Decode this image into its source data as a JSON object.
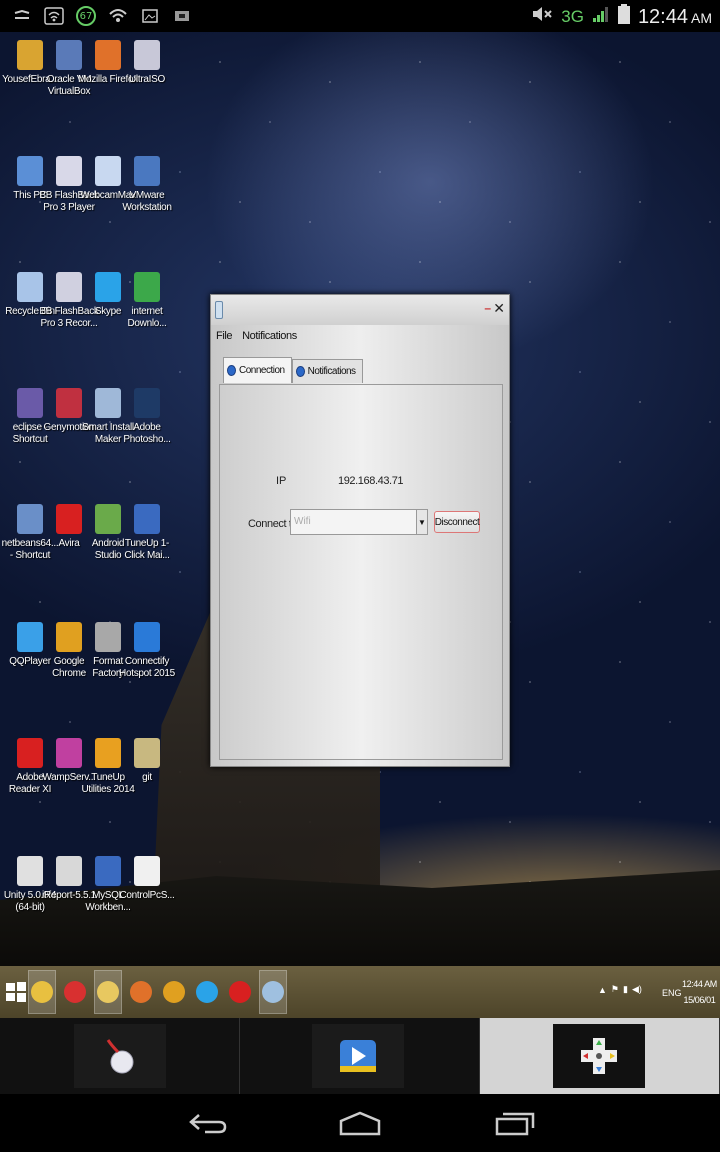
{
  "status_bar": {
    "notification_badge": "67",
    "network": "3G",
    "time": "12:44",
    "ampm": "AM"
  },
  "desktop_icons": [
    {
      "label": "YousefEbra...",
      "color": "#d9a431"
    },
    {
      "label": "Oracle VM VirtualBox",
      "color": "#5a7ab8"
    },
    {
      "label": "Mozilla Firefox",
      "color": "#e0712a"
    },
    {
      "label": "UltraISO",
      "color": "#c8c8d8"
    },
    {
      "label": "This PC",
      "color": "#5b8fd6"
    },
    {
      "label": "BB FlashBack Pro 3 Player",
      "color": "#d8d8e8"
    },
    {
      "label": "WebcamMax",
      "color": "#c8d8f0"
    },
    {
      "label": "VMware Workstation",
      "color": "#4a78c0"
    },
    {
      "label": "Recycle Bin",
      "color": "#a8c4e8"
    },
    {
      "label": "BB FlashBack Pro 3 Recor...",
      "color": "#d0d0e0"
    },
    {
      "label": "Skype",
      "color": "#2aa3e8"
    },
    {
      "label": "internet Downlo...",
      "color": "#3ca84a"
    },
    {
      "label": "eclipse - Shortcut",
      "color": "#6a5aa8"
    },
    {
      "label": "Genymotion",
      "color": "#c03040"
    },
    {
      "label": "Smart Install Maker",
      "color": "#9fb8d8"
    },
    {
      "label": "Adobe Photosho...",
      "color": "#1e3a66"
    },
    {
      "label": "netbeans64... - Shortcut",
      "color": "#6a8fc8"
    },
    {
      "label": "Avira",
      "color": "#d82020"
    },
    {
      "label": "Android Studio",
      "color": "#6aaa4a"
    },
    {
      "label": "TuneUp 1-Click Mai...",
      "color": "#3a6ac0"
    },
    {
      "label": "QQPlayer",
      "color": "#3aa0e8"
    },
    {
      "label": "Google Chrome",
      "color": "#e0a020"
    },
    {
      "label": "Format Factory",
      "color": "#a8a8a8"
    },
    {
      "label": "Connectify Hotspot 2015",
      "color": "#2a7ad8"
    },
    {
      "label": "Adobe Reader XI",
      "color": "#d82020"
    },
    {
      "label": "WampServ...",
      "color": "#c040a0"
    },
    {
      "label": "TuneUp Utilities 2014",
      "color": "#e8a020"
    },
    {
      "label": "git",
      "color": "#c8b880"
    },
    {
      "label": "Unity 5.0.0f4 (64-bit)",
      "color": "#e0e0e0"
    },
    {
      "label": "iReport-5.5.1",
      "color": "#d8d8d8"
    },
    {
      "label": "MySQL Workben...",
      "color": "#3a6ac0"
    },
    {
      "label": "ControlPcS...",
      "color": "#f0f0f0"
    }
  ],
  "window": {
    "menu": [
      "File",
      "Notifications"
    ],
    "tabs": [
      "Connection",
      "Notifications"
    ],
    "ip_label": "IP",
    "ip_value": "192.168.43.71",
    "connect_label": "Connect to",
    "connect_value": "Wifi",
    "disconnect_button": "Disconnect"
  },
  "taskbar": {
    "apps": [
      {
        "name": "file-explorer-icon",
        "color": "#e8c040"
      },
      {
        "name": "alarm-icon",
        "color": "#d83030"
      },
      {
        "name": "folder-icon",
        "color": "#e8c860"
      },
      {
        "name": "firefox-icon",
        "color": "#e0712a"
      },
      {
        "name": "chrome-icon",
        "color": "#e0a020"
      },
      {
        "name": "skype-icon",
        "color": "#2aa3e8"
      },
      {
        "name": "acrobat-icon",
        "color": "#d82020"
      },
      {
        "name": "app-icon",
        "color": "#9fc0e0"
      }
    ],
    "language": "ENG",
    "time": "12:44 AM",
    "date": "15/06/01"
  },
  "colors": {
    "statusbar_accent": "#66cc66",
    "window_face": "#e6e6e6",
    "taskbar": "#5c5236"
  }
}
